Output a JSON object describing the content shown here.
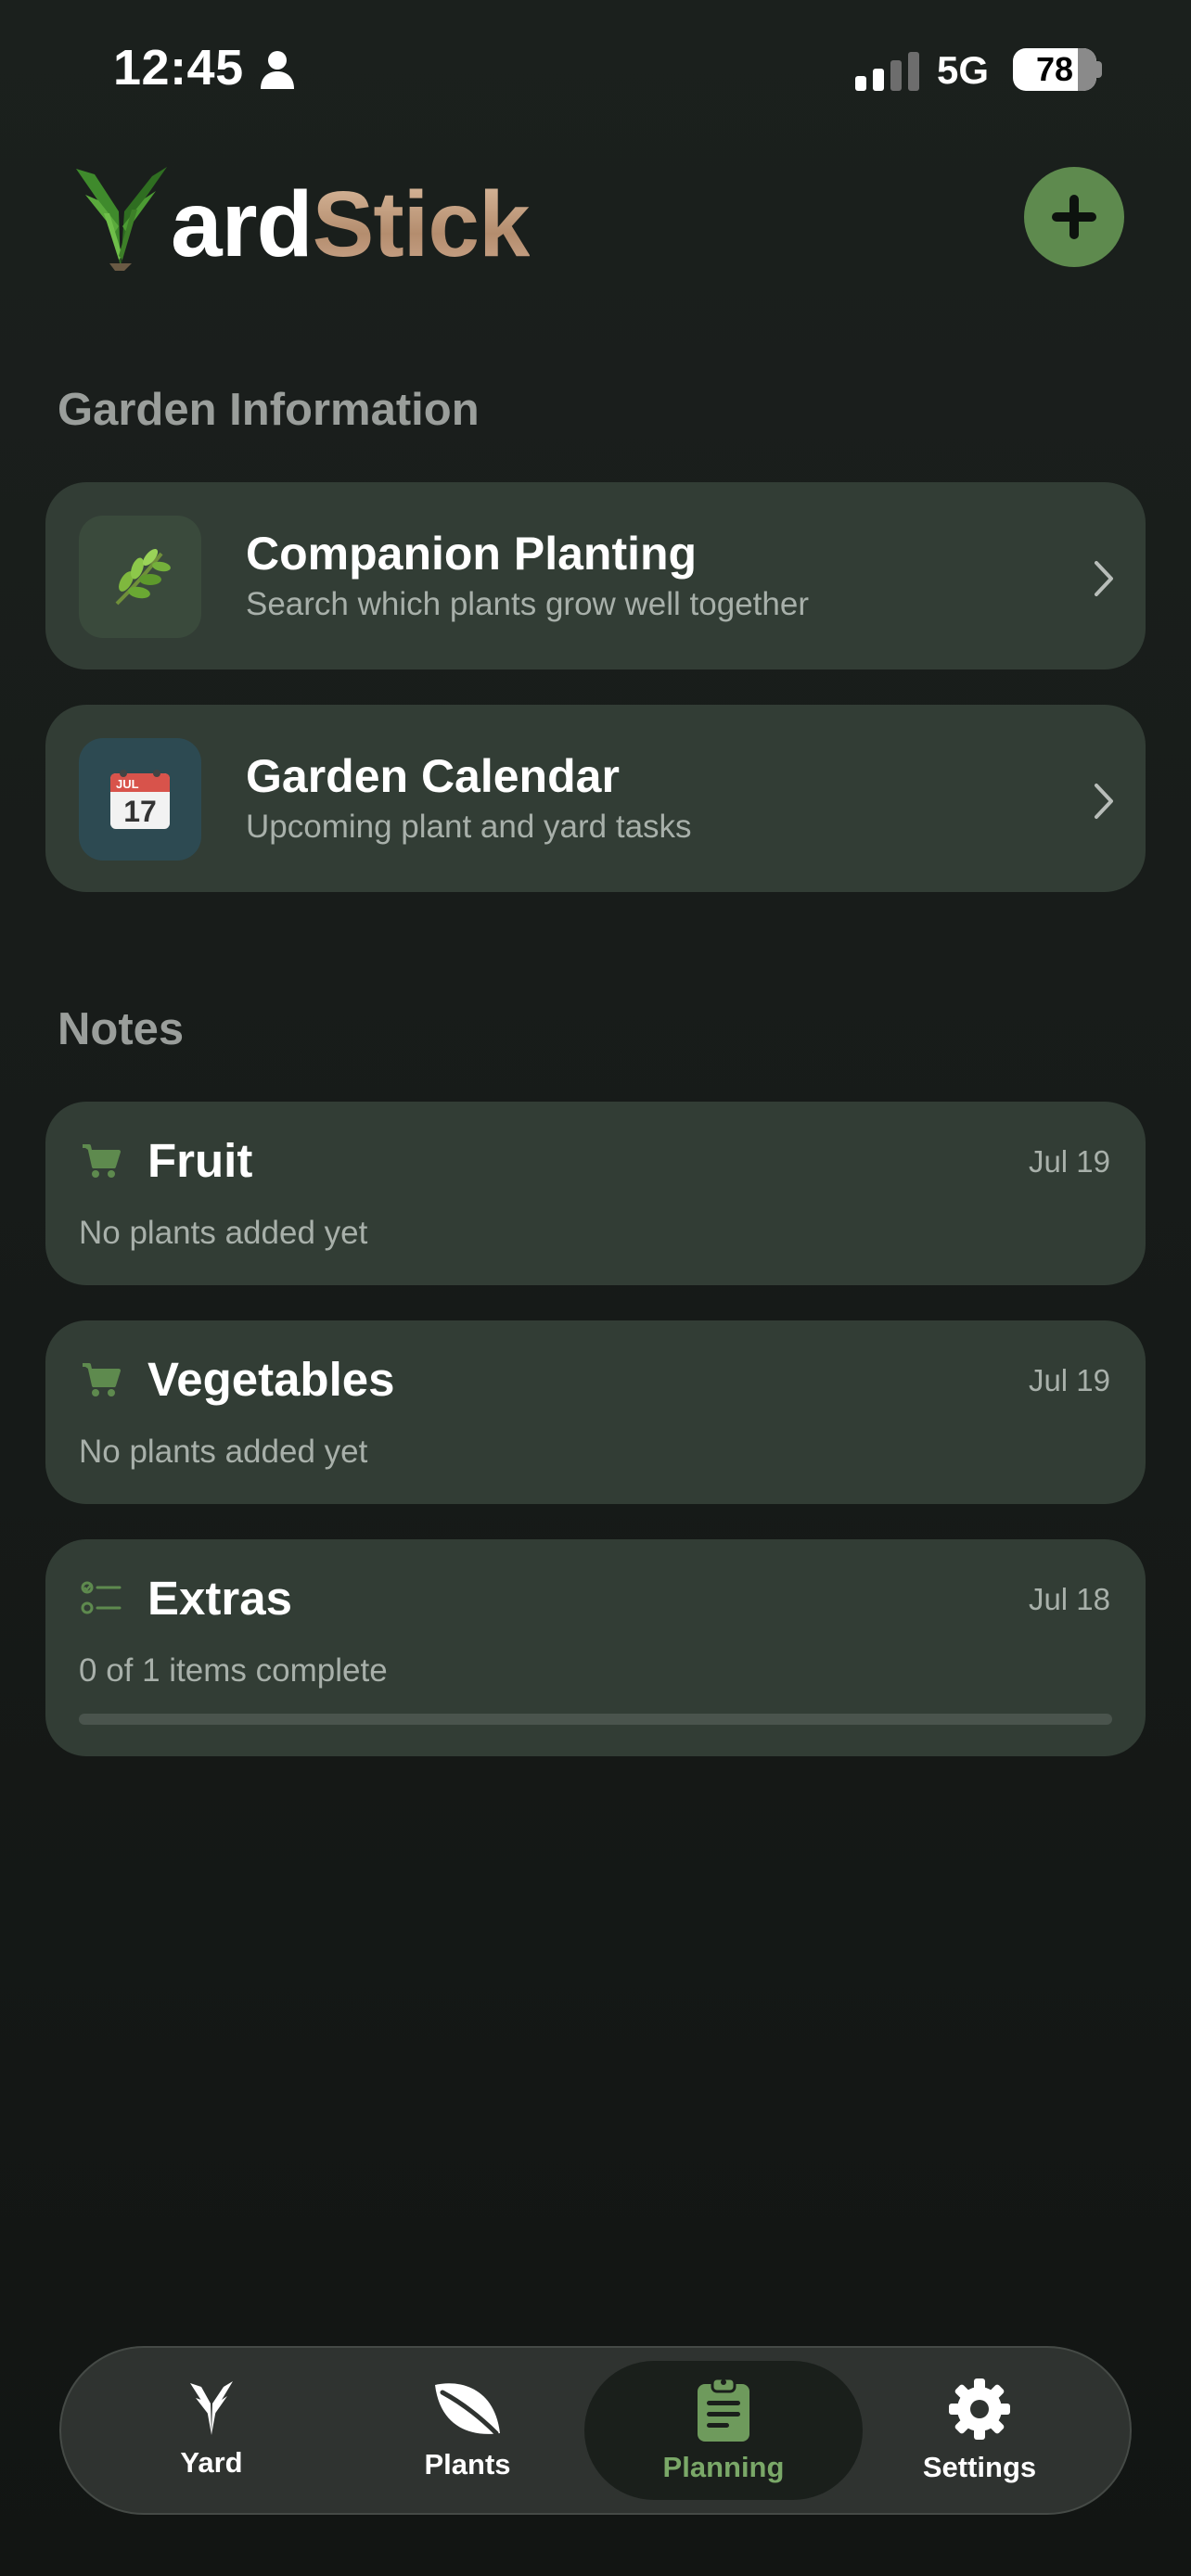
{
  "status_bar": {
    "time": "12:45",
    "network": "5G",
    "battery": "78"
  },
  "header": {
    "logo_prefix": "ard",
    "logo_suffix": "Stick"
  },
  "sections": {
    "garden_info_title": "Garden Information",
    "notes_title": "Notes"
  },
  "garden_info": [
    {
      "title": "Companion Planting",
      "subtitle": "Search which plants grow well together",
      "icon": "herb-icon"
    },
    {
      "title": "Garden Calendar",
      "subtitle": "Upcoming plant and yard tasks",
      "icon": "calendar-icon",
      "calendar_month": "JUL",
      "calendar_day": "17"
    }
  ],
  "notes": [
    {
      "title": "Fruit",
      "date": "Jul 19",
      "subtitle": "No plants added yet",
      "icon": "cart-icon"
    },
    {
      "title": "Vegetables",
      "date": "Jul 19",
      "subtitle": "No plants added yet",
      "icon": "cart-icon"
    },
    {
      "title": "Extras",
      "date": "Jul 18",
      "subtitle": "0 of 1 items complete",
      "icon": "checklist-icon",
      "progress": 0
    }
  ],
  "tabs": [
    {
      "label": "Yard",
      "icon": "yard-icon",
      "active": false
    },
    {
      "label": "Plants",
      "icon": "leaf-icon",
      "active": false
    },
    {
      "label": "Planning",
      "icon": "clipboard-icon",
      "active": true
    },
    {
      "label": "Settings",
      "icon": "gear-icon",
      "active": false
    }
  ],
  "colors": {
    "accent": "#5e8a4e",
    "card": "#323d35",
    "background": "#181c1a",
    "active_tab_label": "#7aa868"
  }
}
